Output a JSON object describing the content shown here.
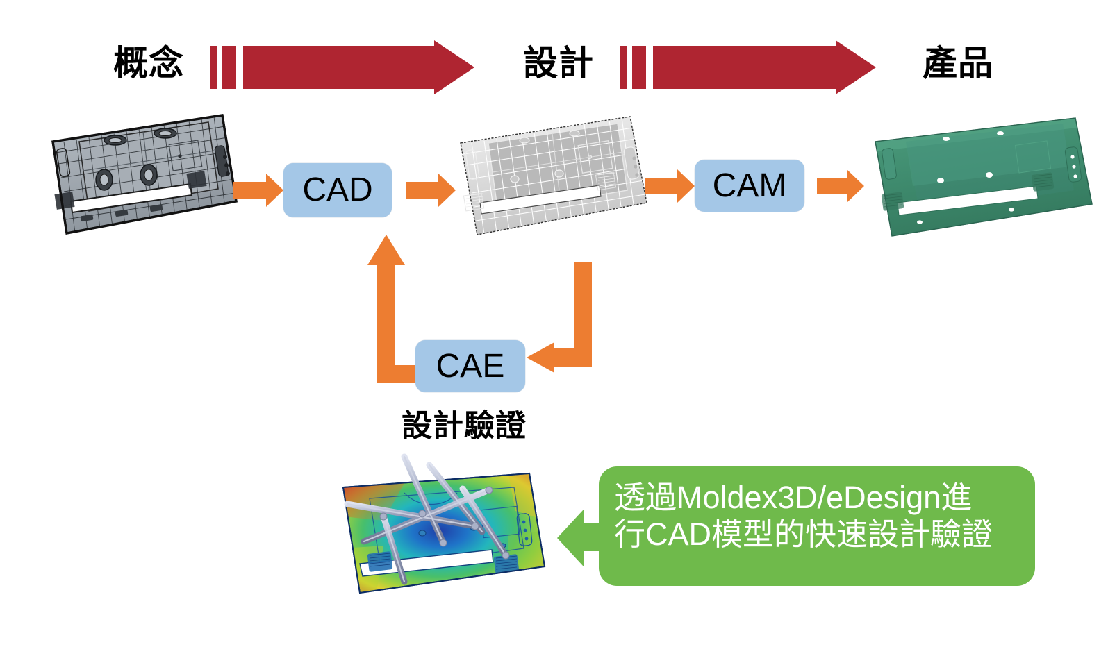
{
  "diagram": {
    "title_stages": [
      {
        "id": "concept",
        "label": "概念"
      },
      {
        "id": "design",
        "label": "設計"
      },
      {
        "id": "product",
        "label": "產品"
      }
    ],
    "process_boxes": [
      {
        "id": "cad",
        "label": "CAD"
      },
      {
        "id": "cam",
        "label": "CAM"
      },
      {
        "id": "cae",
        "label": "CAE"
      }
    ],
    "captions": {
      "verification": "設計驗證"
    },
    "callout": {
      "line1": "透過Moldex3D/eDesign進",
      "line2": "行CAD模型的快速設計驗證",
      "full_text": "透過Moldex3D/eDesign進行CAD模型的快速設計驗證"
    },
    "colors": {
      "stage_arrow_red": "#AF2531",
      "process_box_blue": "#A4C7E7",
      "flow_arrow_orange": "#ED7D31",
      "callout_green": "#6FBA4B",
      "text_black": "#000000",
      "callout_text": "#FFFFFF",
      "product_model_green": "#3F8A6E",
      "concept_model_gray": "#9AA3AB"
    },
    "models": [
      {
        "id": "concept-model",
        "name": "monitor-back-cover-wireframe-dark",
        "style": "black wireframe CAD model"
      },
      {
        "id": "design-model",
        "name": "monitor-back-cover-wireframe-light",
        "style": "white/grey shaded CAD model"
      },
      {
        "id": "product-model",
        "name": "monitor-back-cover-solid-green",
        "style": "green solid rendered part"
      },
      {
        "id": "cae-model",
        "name": "moldflow-warpage-result",
        "style": "rainbow contour CAE result with runner system"
      }
    ]
  }
}
